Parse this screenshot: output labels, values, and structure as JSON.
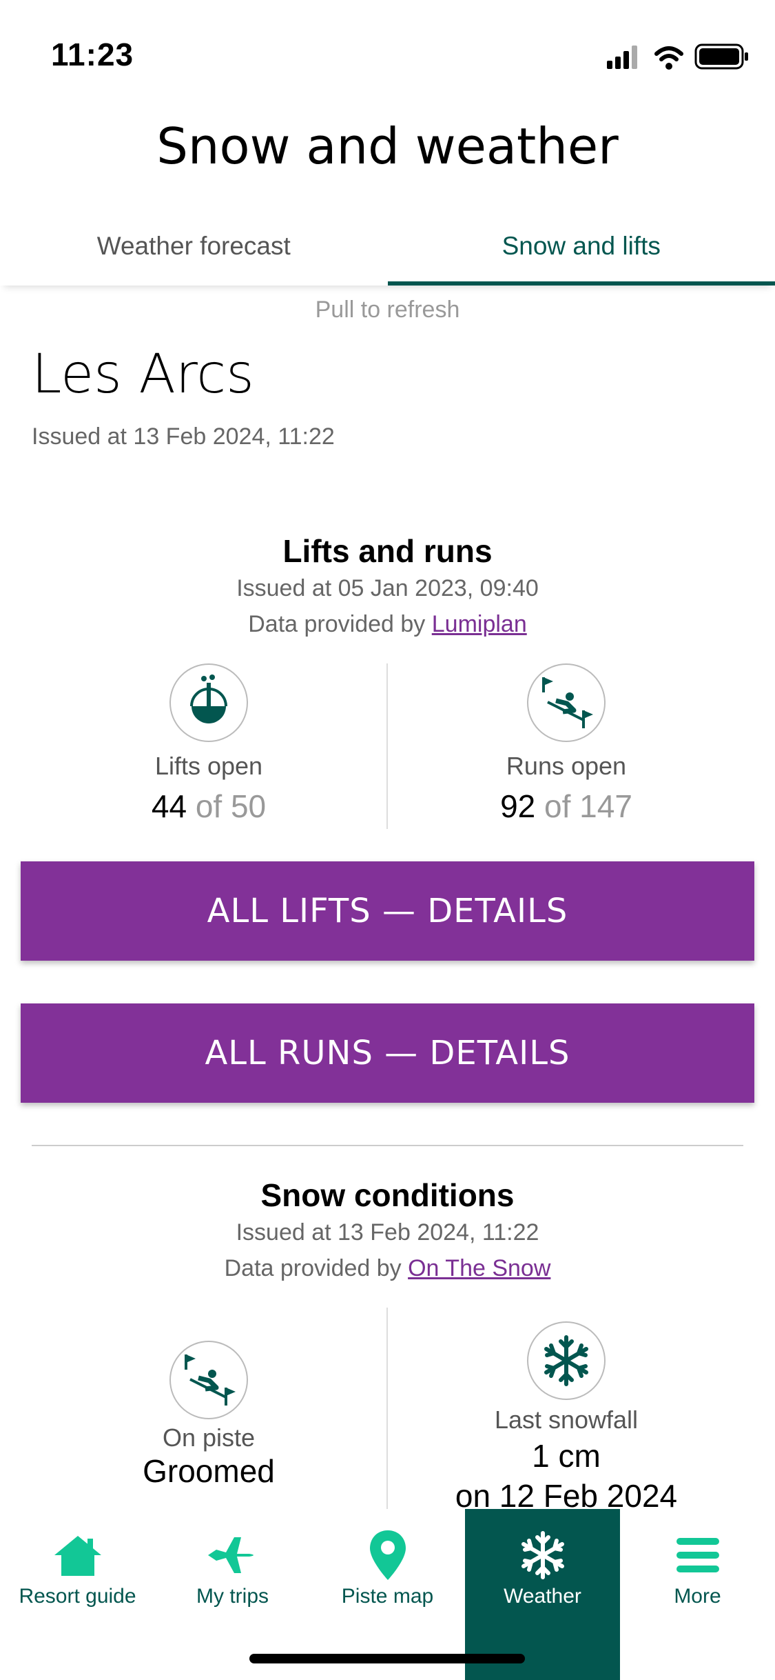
{
  "status": {
    "time": "11:23"
  },
  "header": {
    "title": "Snow and weather"
  },
  "tabs": [
    {
      "label": "Weather forecast",
      "active": false
    },
    {
      "label": "Snow and lifts",
      "active": true
    }
  ],
  "pull_to_refresh": "Pull to refresh",
  "resort": {
    "name": "Les Arcs",
    "issued": "Issued at 13 Feb 2024, 11:22"
  },
  "lifts_runs": {
    "title": "Lifts and runs",
    "issued": "Issued at 05 Jan 2023, 09:40",
    "provider_prefix": "Data provided by",
    "provider": "Lumiplan",
    "lifts": {
      "label": "Lifts open",
      "open": "44",
      "of_text": "of 50"
    },
    "runs": {
      "label": "Runs open",
      "open": "92",
      "of_text": "of 147"
    },
    "lifts_button": "ALL LIFTS — DETAILS",
    "runs_button": "ALL RUNS — DETAILS"
  },
  "snow": {
    "title": "Snow conditions",
    "issued": "Issued at 13 Feb 2024, 11:22",
    "provider_prefix": "Data provided by",
    "provider": "On The Snow",
    "on_piste": {
      "label": "On piste",
      "value": "Groomed"
    },
    "last_snowfall": {
      "label": "Last snowfall",
      "amount": "1 cm",
      "date": "on 12 Feb 2024"
    }
  },
  "nav": [
    {
      "label": "Resort guide",
      "icon": "home-icon",
      "active": false
    },
    {
      "label": "My trips",
      "icon": "plane-icon",
      "active": false
    },
    {
      "label": "Piste map",
      "icon": "map-pin-icon",
      "active": false
    },
    {
      "label": "Weather",
      "icon": "snowflake-icon",
      "active": true
    },
    {
      "label": "More",
      "icon": "menu-icon",
      "active": false
    }
  ],
  "colors": {
    "accent": "#03564f",
    "button": "#823198",
    "link": "#7a2f93",
    "nav_icon": "#12c796"
  }
}
